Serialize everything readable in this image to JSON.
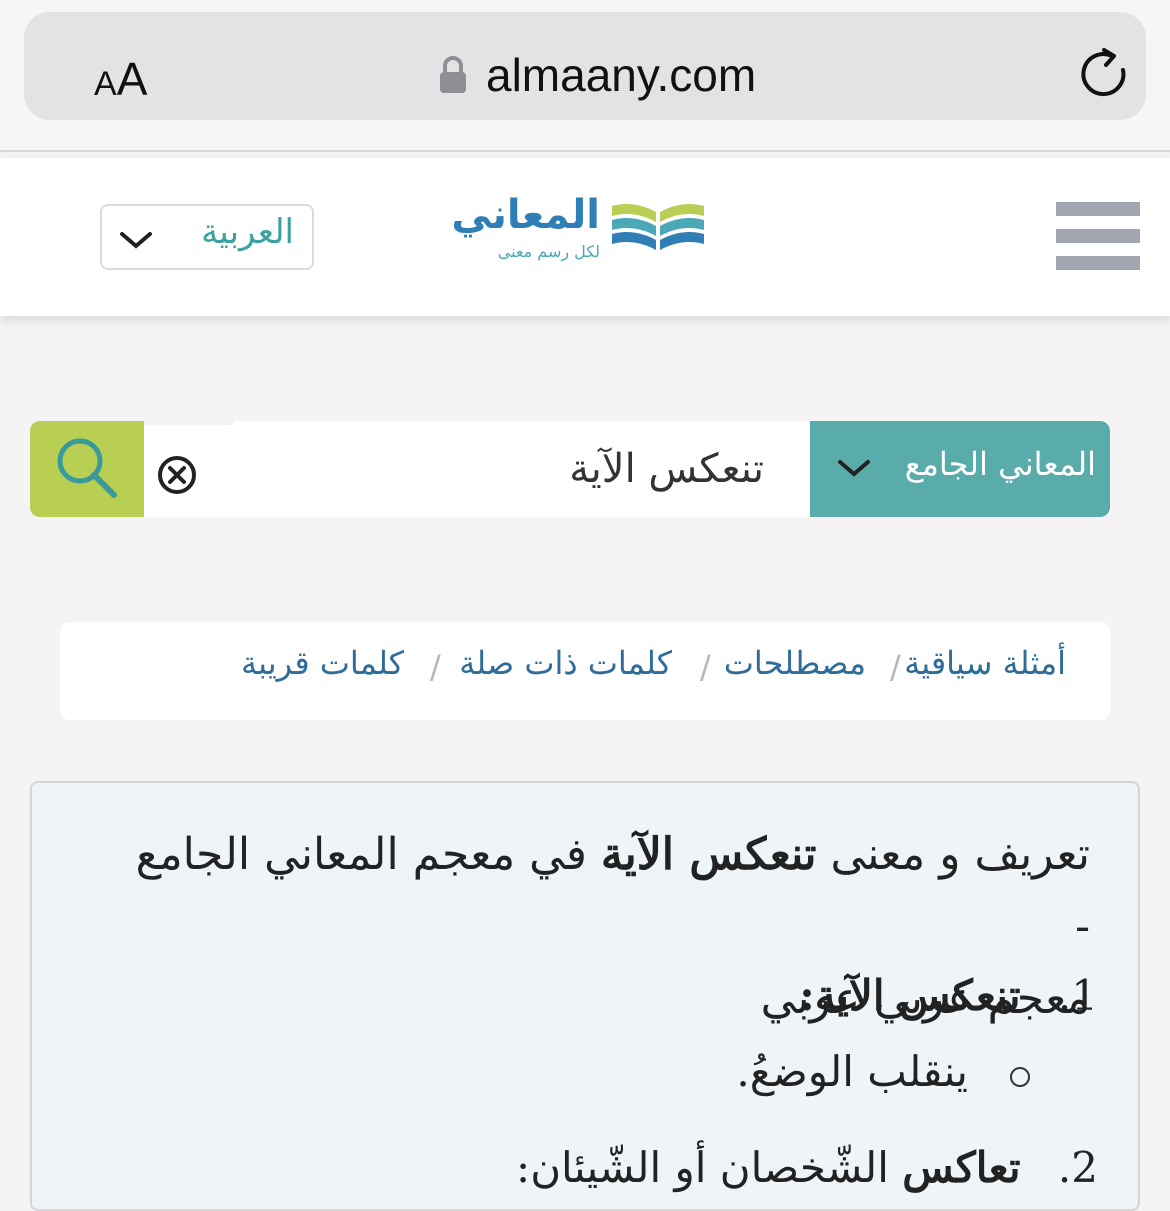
{
  "browser": {
    "text_size_label": "AA",
    "url": "almaany.com",
    "reload_icon": "reload-icon",
    "lock_icon": "lock-icon"
  },
  "header": {
    "language_select": "العربية",
    "logo_name": "المعاني",
    "logo_tagline": "لكل رسم معنى",
    "menu_icon": "hamburger-menu-icon"
  },
  "search": {
    "dictionary_select": "المعاني الجامع",
    "query": "تنعكس الآية",
    "clear_icon": "clear-icon",
    "search_icon": "search-icon",
    "colors": {
      "search_button": "#b9cf54",
      "dictionary_select": "#5aacaa"
    }
  },
  "tabs": [
    {
      "label": "أمثلة سياقية"
    },
    {
      "label": "مصطلحات"
    },
    {
      "label": "كلمات ذات صلة"
    },
    {
      "label": "كلمات قريبة"
    }
  ],
  "tab_separator": "/",
  "result": {
    "title_prefix": "تعريف و معنى",
    "title_word": "تنعكس الآية",
    "title_suffix": "في معجم المعاني الجامع -",
    "title_line2": "معجم عربي عربي",
    "entries": [
      {
        "number": "1.",
        "headword": "تنعكس الآية:",
        "definition": "ينقلب الوضعُ."
      },
      {
        "number": "2.",
        "headword": "تعاكس",
        "definition": "الشّخصان أو الشّيئان:"
      }
    ]
  }
}
